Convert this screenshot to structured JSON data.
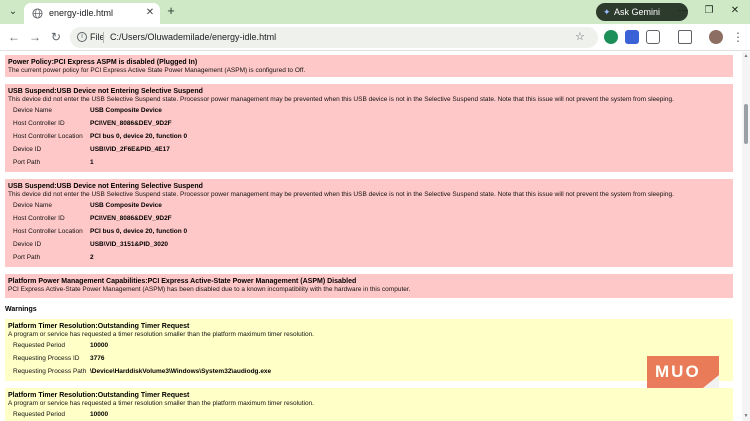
{
  "browser": {
    "tab_title": "energy-idle.html",
    "new_tab_symbol": "+",
    "close_symbol": "✕",
    "gemini_label": "Ask Gemini",
    "address_chip": "File",
    "url": "C:/Users/Oluwademilade/energy-idle.html",
    "icons": {
      "tab_menu": "chevron-down-icon",
      "back": "back-arrow-icon",
      "forward": "forward-arrow-icon",
      "reload": "reload-icon",
      "bookmark": "star-icon",
      "menu": "kebab-menu-icon"
    }
  },
  "report": {
    "errors": [
      {
        "title": "Power Policy:PCI Express ASPM is disabled (Plugged In)",
        "description": "The current power policy for PCI Express Active State Power Management (ASPM) is configured to Off.",
        "fields": []
      },
      {
        "title": "USB Suspend:USB Device not Entering Selective Suspend",
        "description": "This device did not enter the USB Selective Suspend state. Processor power management may be prevented when this USB device is not in the Selective Suspend state. Note that this issue will not prevent the system from sleeping.",
        "fields": [
          {
            "label": "Device Name",
            "value": "USB Composite Device"
          },
          {
            "label": "Host Controller ID",
            "value": "PCI\\VEN_8086&DEV_9D2F"
          },
          {
            "label": "Host Controller Location",
            "value": "PCI bus 0, device 20, function 0"
          },
          {
            "label": "Device ID",
            "value": "USB\\VID_2F6E&PID_4E17"
          },
          {
            "label": "Port Path",
            "value": "1"
          }
        ]
      },
      {
        "title": "USB Suspend:USB Device not Entering Selective Suspend",
        "description": "This device did not enter the USB Selective Suspend state. Processor power management may be prevented when this USB device is not in the Selective Suspend state. Note that this issue will not prevent the system from sleeping.",
        "fields": [
          {
            "label": "Device Name",
            "value": "USB Composite Device"
          },
          {
            "label": "Host Controller ID",
            "value": "PCI\\VEN_8086&DEV_9D2F"
          },
          {
            "label": "Host Controller Location",
            "value": "PCI bus 0, device 20, function 0"
          },
          {
            "label": "Device ID",
            "value": "USB\\VID_3151&PID_3020"
          },
          {
            "label": "Port Path",
            "value": "2"
          }
        ]
      },
      {
        "title": "Platform Power Management Capabilities:PCI Express Active-State Power Management (ASPM) Disabled",
        "description": "PCI Express Active-State Power Management (ASPM) has been disabled due to a known incompatibility with the hardware in this computer.",
        "fields": []
      }
    ],
    "warnings_heading": "Warnings",
    "warnings": [
      {
        "title": "Platform Timer Resolution:Outstanding Timer Request",
        "description": "A program or service has requested a timer resolution smaller than the platform maximum timer resolution.",
        "fields": [
          {
            "label": "Requested Period",
            "value": "10000"
          },
          {
            "label": "Requesting Process ID",
            "value": "3776"
          },
          {
            "label": "Requesting Process Path",
            "value": "\\Device\\HarddiskVolume3\\Windows\\System32\\audiodg.exe"
          }
        ]
      },
      {
        "title": "Platform Timer Resolution:Outstanding Timer Request",
        "description": "A program or service has requested a timer resolution smaller than the platform maximum timer resolution.",
        "fields": [
          {
            "label": "Requested Period",
            "value": "10000"
          }
        ]
      }
    ]
  },
  "watermark": {
    "text": "MUO"
  },
  "colors": {
    "error_bg": "#ffc8c8",
    "warning_bg": "#ffffc8",
    "tabbar_bg": "#cfe9c7",
    "watermark": "#e86d4c"
  }
}
